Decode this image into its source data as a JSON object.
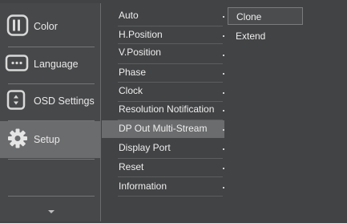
{
  "sidebar": {
    "items": [
      {
        "label": "Color",
        "icon": "color-icon"
      },
      {
        "label": "Language",
        "icon": "language-icon"
      },
      {
        "label": "OSD Settings",
        "icon": "osd-settings-icon"
      },
      {
        "label": "Setup",
        "icon": "gear-icon",
        "active": true
      }
    ],
    "scroll_icon": "chevron-down-icon"
  },
  "menu": {
    "items": [
      {
        "label": "Auto"
      },
      {
        "label": "H.Position"
      },
      {
        "label": "V.Position"
      },
      {
        "label": "Phase"
      },
      {
        "label": "Clock"
      },
      {
        "label": "Resolution Notification"
      },
      {
        "label": "DP Out Multi-Stream",
        "active": true
      },
      {
        "label": "Display Port"
      },
      {
        "label": "Reset"
      },
      {
        "label": "Information"
      }
    ]
  },
  "submenu": {
    "options": [
      {
        "label": "Clone",
        "selected": true
      },
      {
        "label": "Extend"
      }
    ]
  },
  "colors": {
    "background": "#424345",
    "highlight": "#6b6c6e",
    "text": "#eeeeee"
  }
}
